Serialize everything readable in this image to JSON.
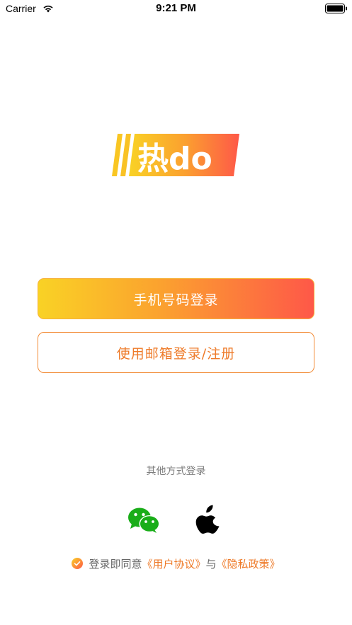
{
  "status_bar": {
    "carrier": "Carrier",
    "time": "9:21 PM"
  },
  "logo": {
    "text": "热do"
  },
  "buttons": {
    "phone_login": "手机号码登录",
    "email_login": "使用邮箱登录/注册"
  },
  "other_login": {
    "label": "其他方式登录",
    "providers": [
      "wechat-icon",
      "apple-icon"
    ]
  },
  "agreement": {
    "prefix": "登录即同意",
    "user_agreement": "《用户协议》",
    "conjunction": "与",
    "privacy_policy": "《隐私政策》",
    "checked": true
  },
  "colors": {
    "accent": "#ee7a28",
    "gradient_start": "#f9d225",
    "gradient_end": "#fe5848",
    "wechat_green": "#1aad19"
  }
}
